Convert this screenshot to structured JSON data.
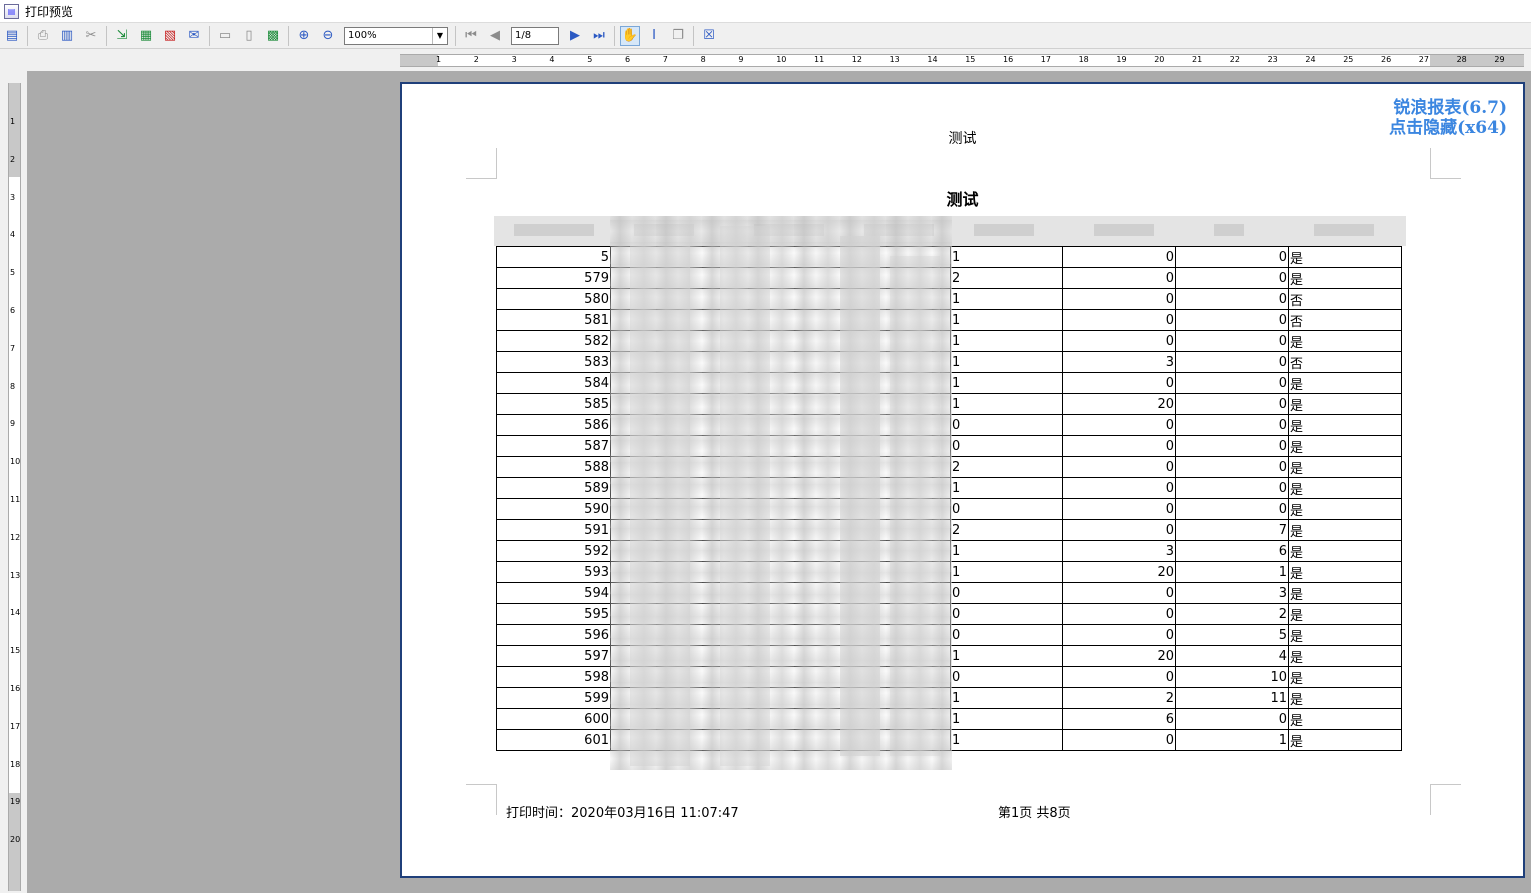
{
  "window": {
    "title": "打印预览"
  },
  "toolbar": {
    "zoom_value": "100%",
    "page_value": "1/8"
  },
  "ruler": {
    "top_numbers": [
      "1",
      "2",
      "3",
      "4",
      "5",
      "6",
      "7",
      "8",
      "9",
      "10",
      "11",
      "12",
      "13",
      "14",
      "15",
      "16",
      "17",
      "18",
      "19",
      "20",
      "21",
      "22",
      "23",
      "24",
      "25",
      "26",
      "27",
      "28",
      "29"
    ],
    "left_numbers": [
      "1",
      "2",
      "3",
      "4",
      "5",
      "6",
      "7",
      "8",
      "9",
      "10",
      "11",
      "12",
      "13",
      "14",
      "15",
      "16",
      "17",
      "18",
      "19",
      "20"
    ]
  },
  "page": {
    "watermark_line1": "锐浪报表(6.7)",
    "watermark_line2": "点击隐藏(x64)",
    "header_title": "测试",
    "report_title": "测试",
    "footer_time": "打印时间：2020年03月16日 11:07:47",
    "footer_page": "第1页 共8页"
  },
  "table": {
    "rows": [
      {
        "id": "5",
        "a": "1",
        "b": "0",
        "c": "0",
        "d": "是"
      },
      {
        "id": "579",
        "a": "2",
        "b": "0",
        "c": "0",
        "d": "是"
      },
      {
        "id": "580",
        "a": "1",
        "b": "0",
        "c": "0",
        "d": "否"
      },
      {
        "id": "581",
        "a": "1",
        "b": "0",
        "c": "0",
        "d": "否"
      },
      {
        "id": "582",
        "a": "1",
        "b": "0",
        "c": "0",
        "d": "是"
      },
      {
        "id": "583",
        "a": "1",
        "b": "3",
        "c": "0",
        "d": "否"
      },
      {
        "id": "584",
        "a": "1",
        "b": "0",
        "c": "0",
        "d": "是"
      },
      {
        "id": "585",
        "a": "1",
        "b": "20",
        "c": "0",
        "d": "是"
      },
      {
        "id": "586",
        "a": "0",
        "b": "0",
        "c": "0",
        "d": "是"
      },
      {
        "id": "587",
        "a": "0",
        "b": "0",
        "c": "0",
        "d": "是"
      },
      {
        "id": "588",
        "a": "2",
        "b": "0",
        "c": "0",
        "d": "是"
      },
      {
        "id": "589",
        "a": "1",
        "b": "0",
        "c": "0",
        "d": "是"
      },
      {
        "id": "590",
        "a": "0",
        "b": "0",
        "c": "0",
        "d": "是"
      },
      {
        "id": "591",
        "a": "2",
        "b": "0",
        "c": "7",
        "d": "是"
      },
      {
        "id": "592",
        "a": "1",
        "b": "3",
        "c": "6",
        "d": "是"
      },
      {
        "id": "593",
        "a": "1",
        "b": "20",
        "c": "1",
        "d": "是"
      },
      {
        "id": "594",
        "a": "0",
        "b": "0",
        "c": "3",
        "d": "是"
      },
      {
        "id": "595",
        "a": "0",
        "b": "0",
        "c": "2",
        "d": "是"
      },
      {
        "id": "596",
        "a": "0",
        "b": "0",
        "c": "5",
        "d": "是"
      },
      {
        "id": "597",
        "a": "1",
        "b": "20",
        "c": "4",
        "d": "是"
      },
      {
        "id": "598",
        "a": "0",
        "b": "0",
        "c": "10",
        "d": "是"
      },
      {
        "id": "599",
        "a": "1",
        "b": "2",
        "c": "11",
        "d": "是"
      },
      {
        "id": "600",
        "a": "1",
        "b": "6",
        "c": "0",
        "d": "是"
      },
      {
        "id": "601",
        "a": "1",
        "b": "0",
        "c": "1",
        "d": "是"
      }
    ]
  }
}
